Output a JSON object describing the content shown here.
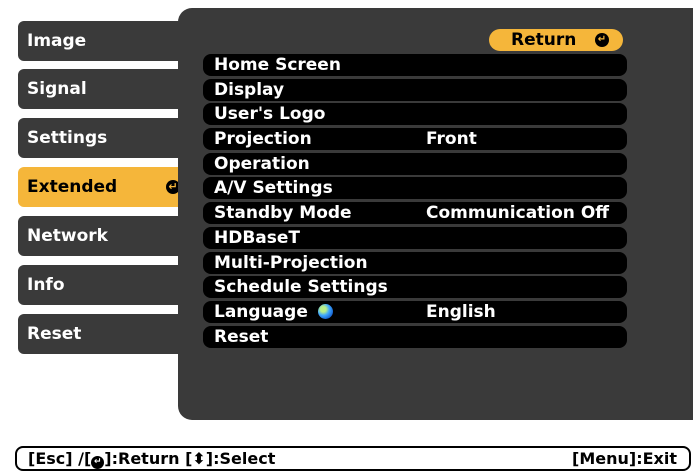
{
  "tabs": [
    {
      "label": "Image"
    },
    {
      "label": "Signal"
    },
    {
      "label": "Settings"
    },
    {
      "label": "Extended",
      "active": true
    },
    {
      "label": "Network"
    },
    {
      "label": "Info"
    },
    {
      "label": "Reset"
    }
  ],
  "return_label": "Return",
  "menu": [
    {
      "label": "Home Screen",
      "value": ""
    },
    {
      "label": "Display",
      "value": ""
    },
    {
      "label": "User's Logo",
      "value": ""
    },
    {
      "label": "Projection",
      "value": "Front"
    },
    {
      "label": "Operation",
      "value": ""
    },
    {
      "label": "A/V Settings",
      "value": ""
    },
    {
      "label": "Standby Mode",
      "value": "Communication Off"
    },
    {
      "label": "HDBaseT",
      "value": ""
    },
    {
      "label": "Multi-Projection",
      "value": ""
    },
    {
      "label": "Schedule Settings",
      "value": ""
    },
    {
      "label": "Language",
      "value": "English"
    },
    {
      "label": "Reset",
      "value": ""
    }
  ],
  "help": {
    "esc": "[Esc] /[",
    "return": "]:Return  [",
    "select": "]:Select",
    "exit": "[Menu]:Exit"
  },
  "colors": {
    "accent": "#f5b63a",
    "panel": "#3a3a3a",
    "row": "#000000"
  }
}
